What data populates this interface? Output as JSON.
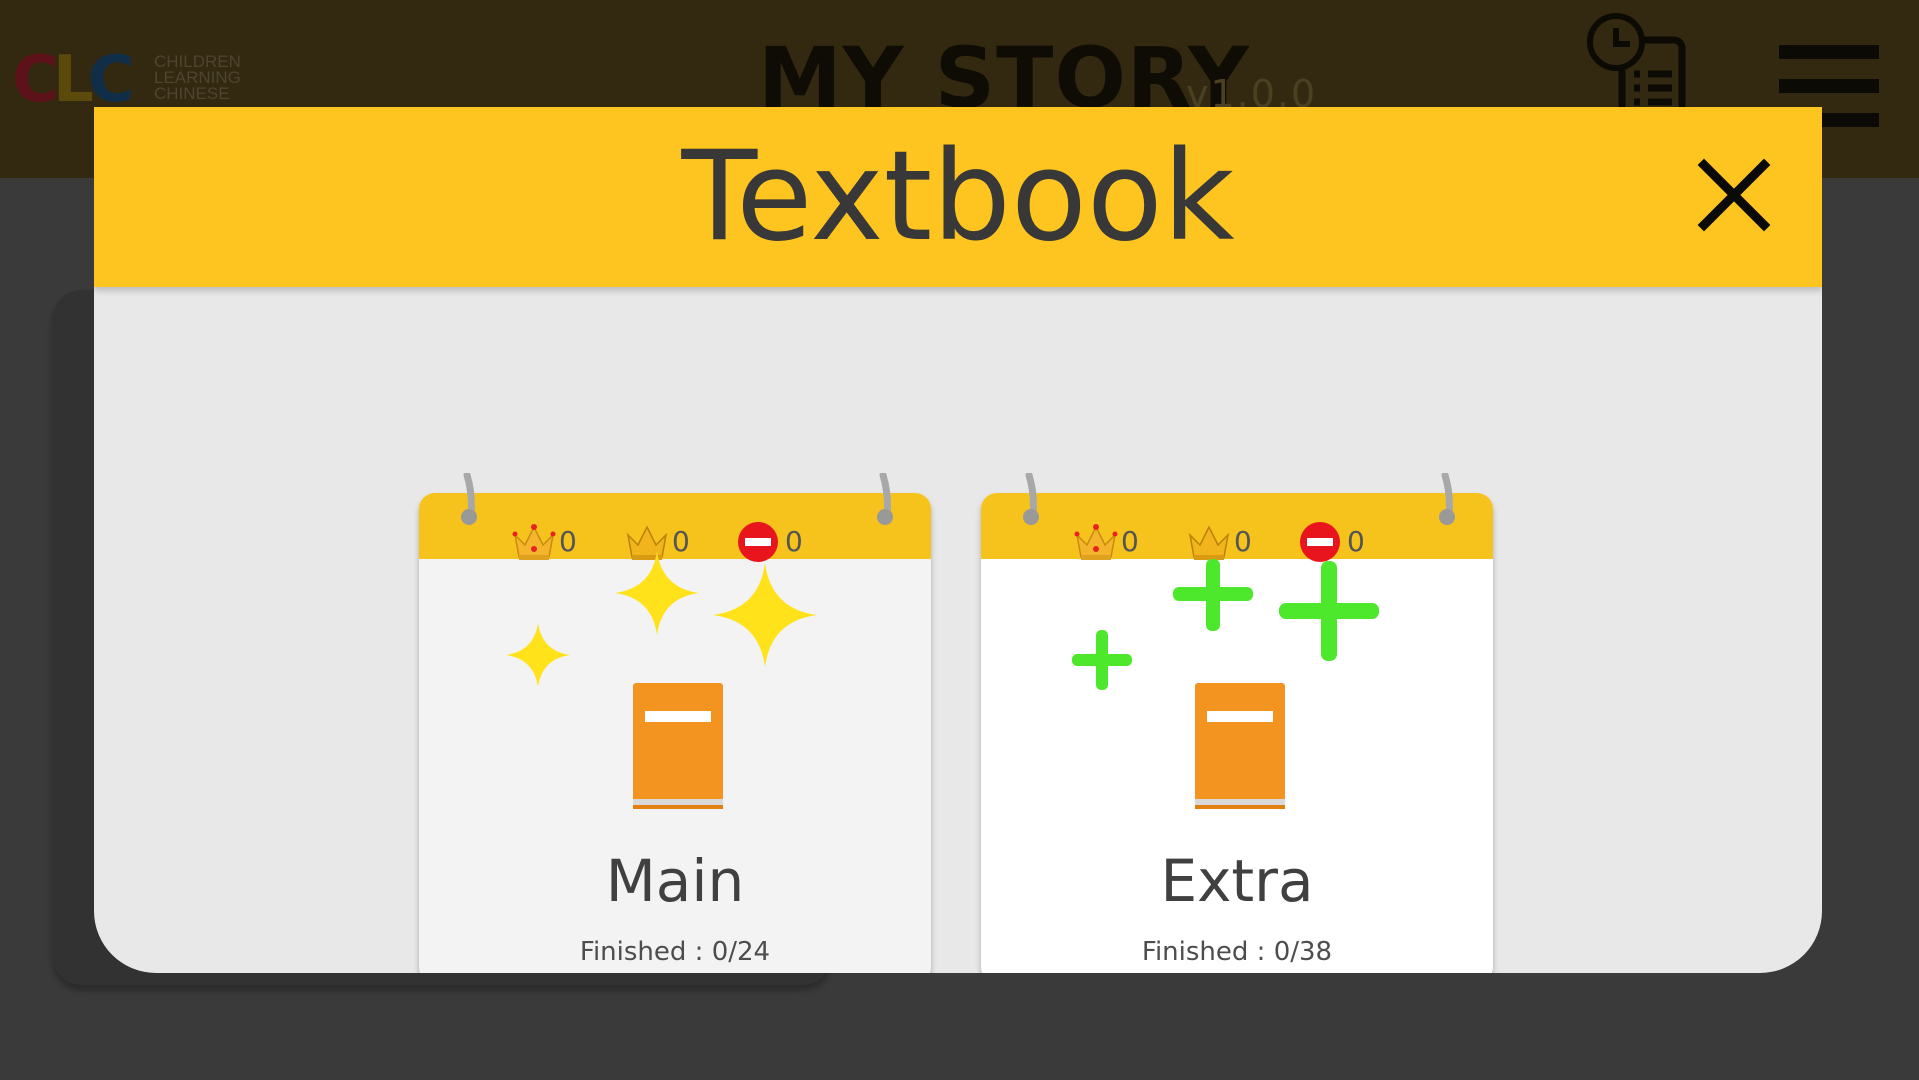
{
  "app": {
    "logo": {
      "letters": [
        "C",
        "L",
        "C"
      ],
      "lines": [
        "CHILDREN",
        "LEARNING",
        "CHINESE"
      ]
    },
    "title": "MY STORY",
    "version": "v1.0.0",
    "history_icon": "history-list-icon",
    "menu_icon": "hamburger-menu-icon"
  },
  "modal": {
    "title": "Textbook",
    "close_icon": "close-icon",
    "accent_color": "#fec41f",
    "cards": [
      {
        "name": "Main",
        "progress": "Finished : 0/24",
        "gold_crowns": "0",
        "silver_crowns": "0",
        "blocked": "0",
        "decoration": "sparkle-icons",
        "decoration_color": "#ffe21a"
      },
      {
        "name": "Extra",
        "progress": "Finished : 0/38",
        "gold_crowns": "0",
        "silver_crowns": "0",
        "blocked": "0",
        "decoration": "plus-icons",
        "decoration_color": "#4de82c"
      }
    ]
  }
}
